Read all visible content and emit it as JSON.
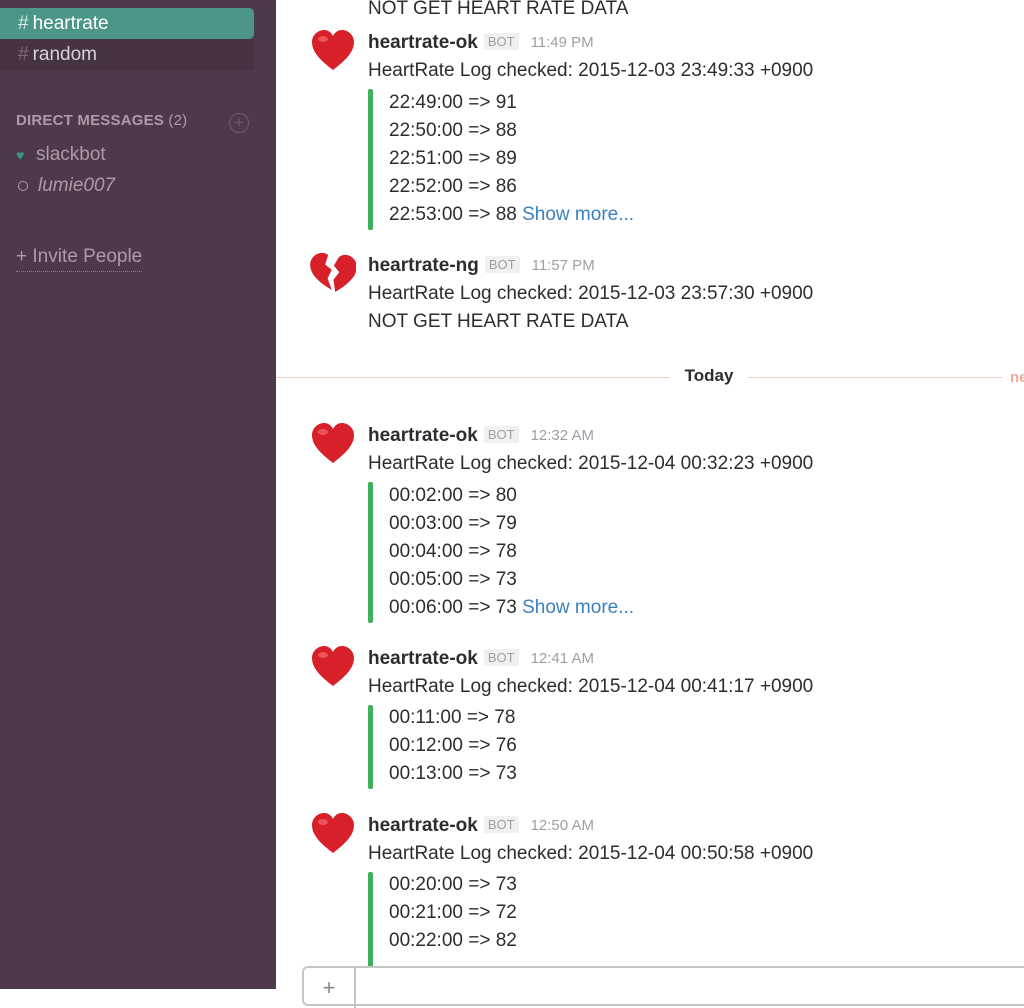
{
  "sidebar": {
    "channels": [
      {
        "hash": "#",
        "name": "heartrate",
        "active": true
      },
      {
        "hash": "#",
        "name": "random",
        "active": false
      }
    ],
    "dm_section": {
      "title": "DIRECT MESSAGES",
      "count": "(2)",
      "add_icon": "plus-circle-icon"
    },
    "dms": [
      {
        "name": "slackbot",
        "presence": "heart-icon"
      },
      {
        "name": "lumie007",
        "presence": "away-circle-icon"
      }
    ],
    "invite": {
      "icon": "+",
      "label": "Invite People"
    }
  },
  "top_partial": {
    "text": "NOT GET HEART RATE DATA"
  },
  "messages": [
    {
      "author": "heartrate-ok",
      "badge": "BOT",
      "time": "11:49 PM",
      "avatar": "red-heart-icon",
      "text": "HeartRate Log checked: 2015-12-03 23:49:33 +0900",
      "lines": [
        "22:49:00 => 91",
        "22:50:00 => 88",
        "22:51:00 => 89",
        "22:52:00 => 86",
        "22:53:00 => 88"
      ],
      "show_more": "Show more..."
    },
    {
      "author": "heartrate-ng",
      "badge": "BOT",
      "time": "11:57 PM",
      "avatar": "broken-heart-icon",
      "text": "HeartRate Log checked: 2015-12-03 23:57:30 +0900",
      "text2": "NOT GET HEART RATE DATA"
    },
    {
      "author": "heartrate-ok",
      "badge": "BOT",
      "time": "12:32 AM",
      "avatar": "red-heart-icon",
      "text": "HeartRate Log checked: 2015-12-04 00:32:23 +0900",
      "lines": [
        "00:02:00 => 80",
        "00:03:00 => 79",
        "00:04:00 => 78",
        "00:05:00 => 73",
        "00:06:00 => 73"
      ],
      "show_more": "Show more..."
    },
    {
      "author": "heartrate-ok",
      "badge": "BOT",
      "time": "12:41 AM",
      "avatar": "red-heart-icon",
      "text": "HeartRate Log checked: 2015-12-04 00:41:17 +0900",
      "lines": [
        "00:11:00 => 78",
        "00:12:00 => 76",
        "00:13:00 => 73"
      ]
    },
    {
      "author": "heartrate-ok",
      "badge": "BOT",
      "time": "12:50 AM",
      "avatar": "red-heart-icon",
      "text": "HeartRate Log checked: 2015-12-04 00:50:58 +0900",
      "lines": [
        "00:20:00 => 73",
        "00:21:00 => 72",
        "00:22:00 => 82"
      ]
    }
  ],
  "divider": {
    "label": "Today",
    "new_label": "ne"
  },
  "composer": {
    "plus": "+"
  },
  "colors": {
    "sidebar_bg": "#4d394b",
    "active_channel": "#4c9689",
    "attachment_bar": "#3eb15a",
    "link": "#3a7fbf"
  }
}
